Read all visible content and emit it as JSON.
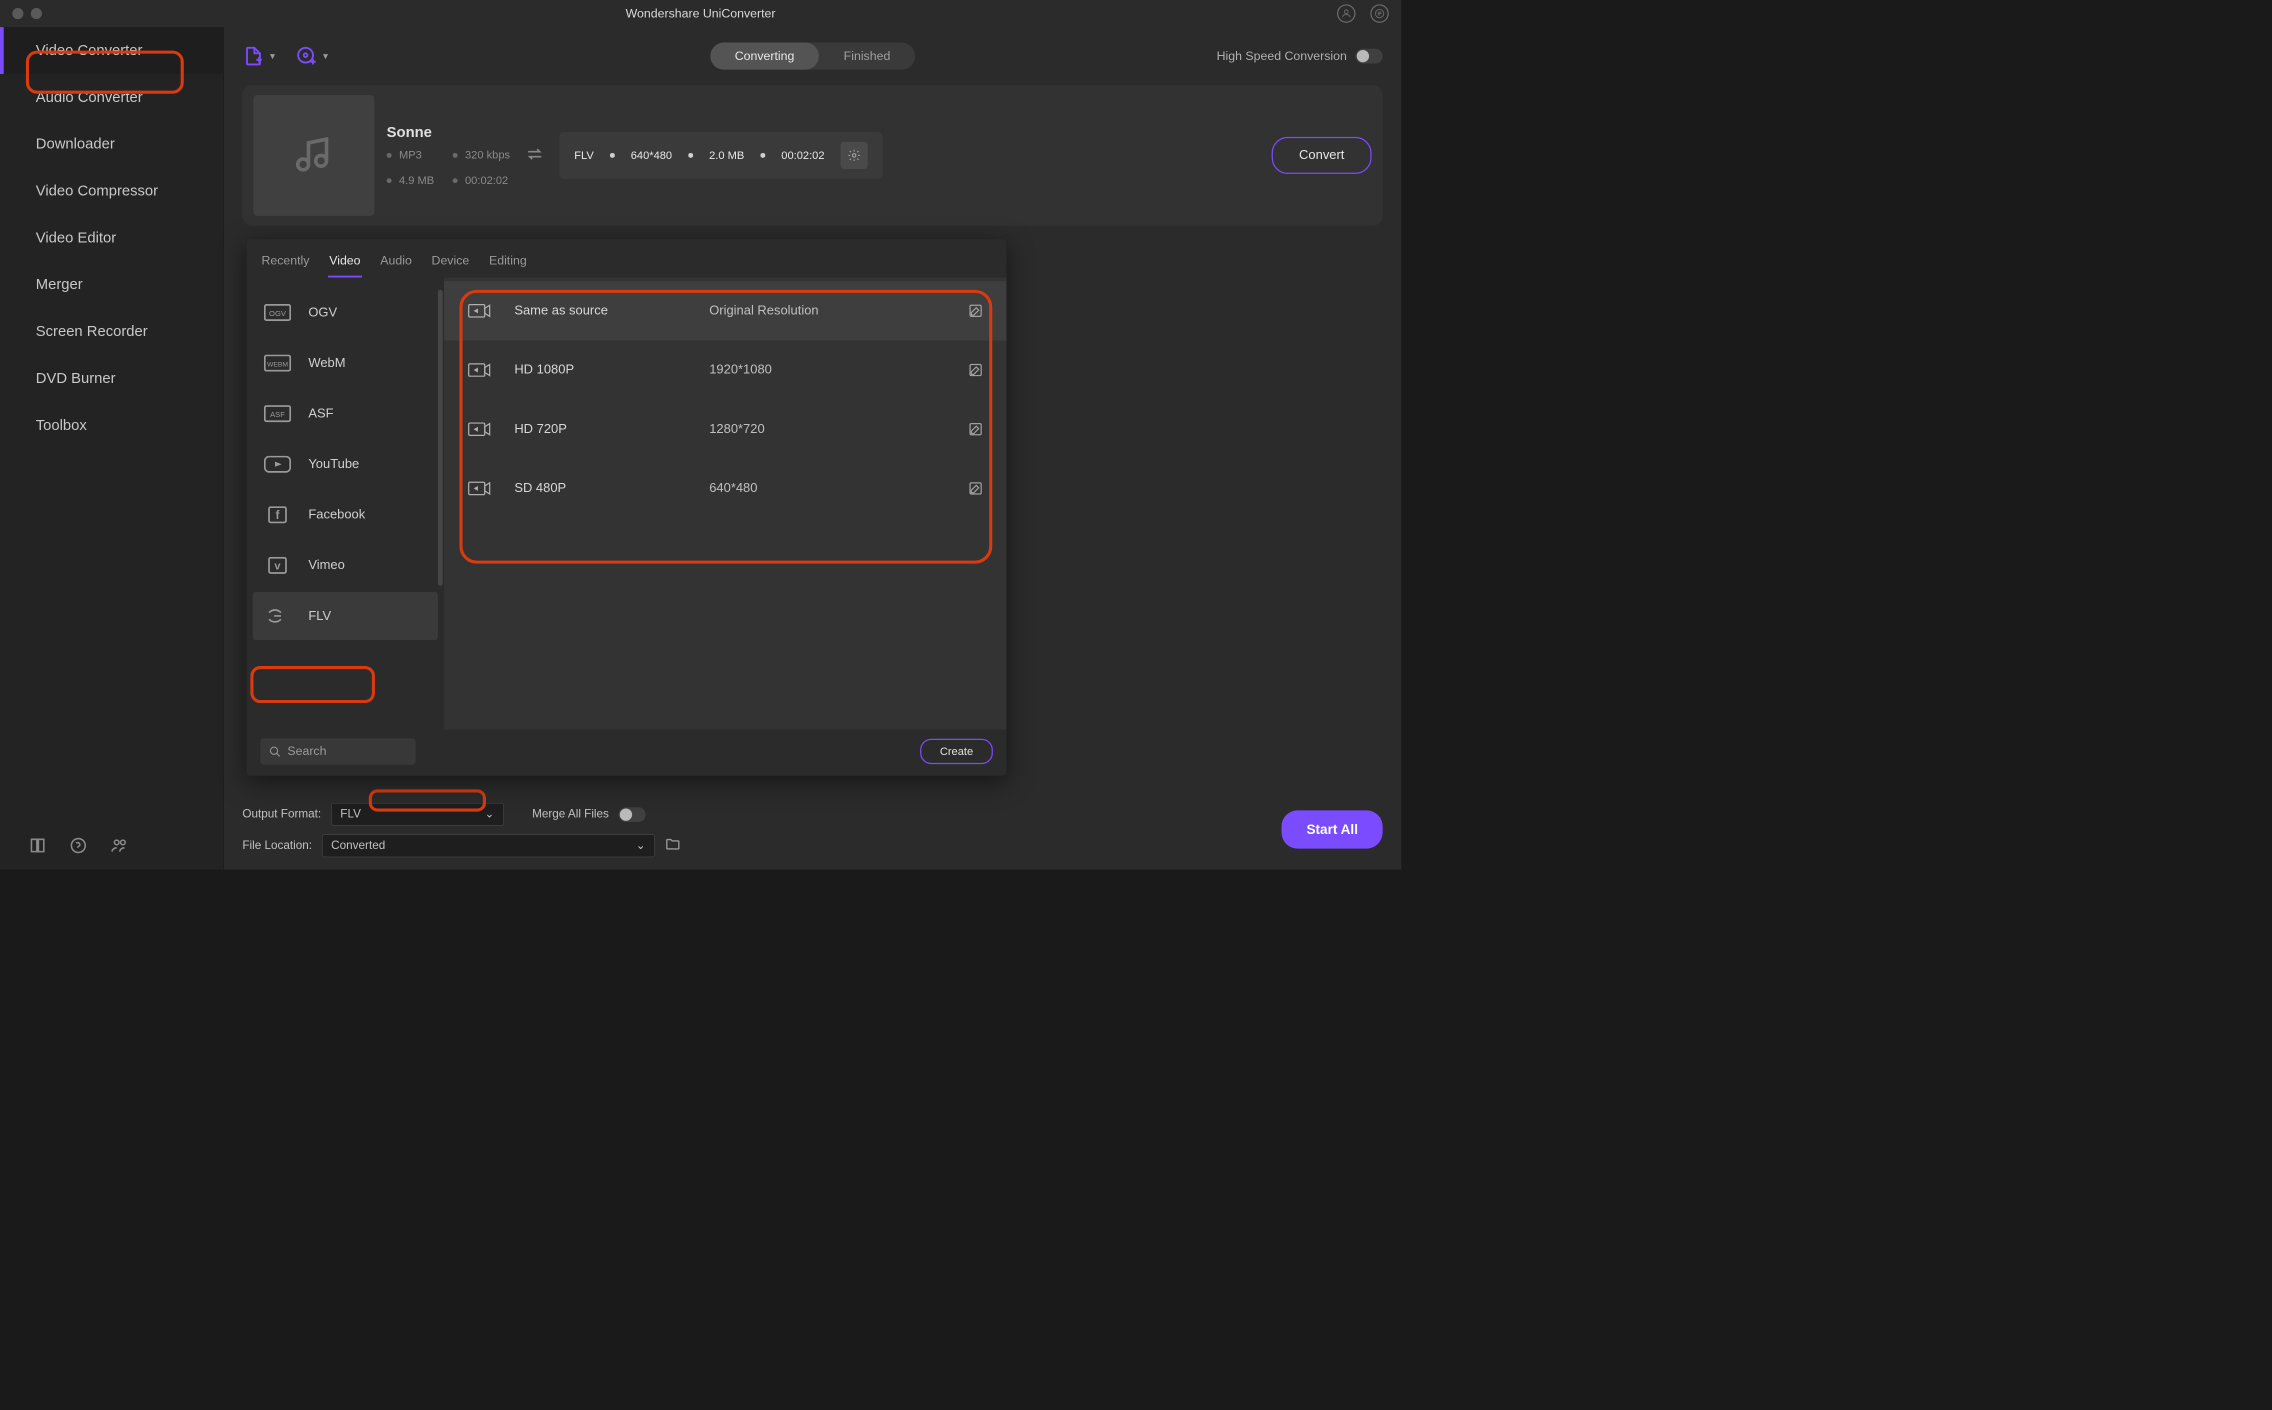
{
  "title": "Wondershare UniConverter",
  "sidebar": {
    "items": [
      {
        "label": "Video Converter"
      },
      {
        "label": "Audio Converter"
      },
      {
        "label": "Downloader"
      },
      {
        "label": "Video Compressor"
      },
      {
        "label": "Video Editor"
      },
      {
        "label": "Merger"
      },
      {
        "label": "Screen Recorder"
      },
      {
        "label": "DVD Burner"
      },
      {
        "label": "Toolbox"
      }
    ]
  },
  "tabs": {
    "converting": "Converting",
    "finished": "Finished"
  },
  "high_speed_label": "High Speed Conversion",
  "file": {
    "title": "Sonne",
    "in": {
      "codec": "MP3",
      "bitrate": "320 kbps",
      "size": "4.9 MB",
      "duration": "00:02:02"
    },
    "out": {
      "fmt": "FLV",
      "res": "640*480",
      "size": "2.0 MB",
      "duration": "00:02:02"
    },
    "convert_btn": "Convert"
  },
  "popover": {
    "tabs": [
      "Recently",
      "Video",
      "Audio",
      "Device",
      "Editing"
    ],
    "formats": [
      "OGV",
      "WebM",
      "ASF",
      "YouTube",
      "Facebook",
      "Vimeo",
      "FLV"
    ],
    "resolutions": [
      {
        "name": "Same as source",
        "res": "Original Resolution"
      },
      {
        "name": "HD 1080P",
        "res": "1920*1080"
      },
      {
        "name": "HD 720P",
        "res": "1280*720"
      },
      {
        "name": "SD 480P",
        "res": "640*480"
      }
    ],
    "search_placeholder": "Search",
    "create_btn": "Create"
  },
  "bottom": {
    "output_format_label": "Output Format:",
    "output_format_value": "FLV",
    "merge_label": "Merge All Files",
    "file_location_label": "File Location:",
    "file_location_value": "Converted",
    "start_all": "Start All"
  }
}
